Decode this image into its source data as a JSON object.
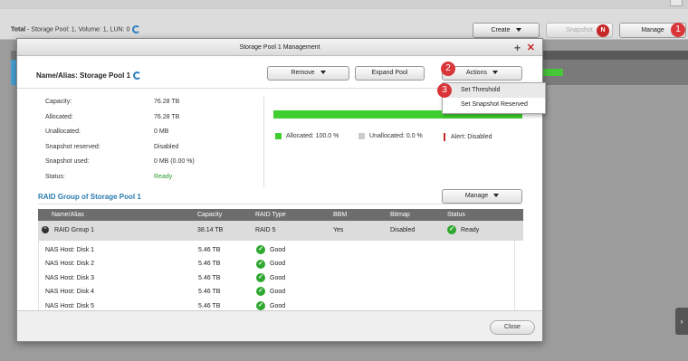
{
  "background": {
    "total_label": "Total",
    "total_rest": " - Storage Pool: 1, Volume: 1, LUN: 0",
    "create_label": "Create",
    "snapshot_label": "Snapshot",
    "snapshot_badge": "N",
    "manage_label": "Manage",
    "step1": "1"
  },
  "modal": {
    "title": "Storage Pool 1 Management",
    "name_label": "Name/Alias: Storage Pool 1",
    "remove_label": "Remove",
    "expand_label": "Expand Pool",
    "actions_label": "Actions",
    "step2": "2",
    "step3": "3",
    "dropdown": [
      "Set Threshold",
      "Set Snapshot Reserved"
    ],
    "info": [
      {
        "k": "Capacity:",
        "v": "76.28 TB"
      },
      {
        "k": "Allocated:",
        "v": "76.28 TB"
      },
      {
        "k": "Unallocated:",
        "v": "0 MB"
      },
      {
        "k": "Snapshot reserved:",
        "v": "Disabled"
      },
      {
        "k": "Snapshot used:",
        "v": "0 MB (0.00 %)"
      },
      {
        "k": "Status:",
        "v": "Ready"
      }
    ],
    "allocated_fraction": 1.0,
    "legend": {
      "allocated": "Allocated: 100.0 %",
      "unallocated": "Unallocated: 0.0 %",
      "alert": "Alert: Disabled"
    },
    "colors": {
      "allocated": "#3fcf2f",
      "unallocated": "#cccccc",
      "alert": "#c62828"
    },
    "raid_title": "RAID Group of Storage Pool 1",
    "raid_manage_label": "Manage",
    "table": {
      "headers": [
        "Name/Alias",
        "Capacity",
        "RAID Type",
        "BBM",
        "Bitmap",
        "Status"
      ],
      "group": {
        "name": "RAID Group 1",
        "capacity": "38.14 TB",
        "raid_type": "RAID 5",
        "bbm": "Yes",
        "bitmap": "Disabled",
        "status": "Ready"
      },
      "disks": [
        {
          "name": "NAS Host: Disk 1",
          "capacity": "5.46 TB",
          "status": "Good"
        },
        {
          "name": "NAS Host: Disk 2",
          "capacity": "5.46 TB",
          "status": "Good"
        },
        {
          "name": "NAS Host: Disk 3",
          "capacity": "5.46 TB",
          "status": "Good"
        },
        {
          "name": "NAS Host: Disk 4",
          "capacity": "5.46 TB",
          "status": "Good"
        },
        {
          "name": "NAS Host: Disk 5",
          "capacity": "5.46 TB",
          "status": "Good"
        }
      ]
    },
    "close_label": "Close"
  }
}
